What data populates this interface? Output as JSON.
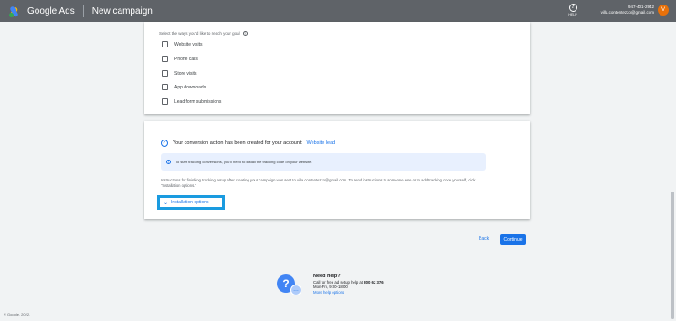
{
  "header": {
    "app_name": "Google Ads",
    "page_title": "New campaign",
    "help_label": "HELP",
    "account_phone": "947-401-2942",
    "account_email": "villa.contentezzo@gmail.com",
    "avatar_letter": "V"
  },
  "goals": {
    "label": "Select the ways you'd like to reach your goal",
    "options": [
      "Website visits",
      "Phone calls",
      "Store visits",
      "App downloads",
      "Lead form submissions"
    ]
  },
  "conversion": {
    "success_text": "Your conversion action has been created for your account:",
    "success_link": "Website lead",
    "info_text": "To start tracking conversions, you'll need to install the tracking code on your website.",
    "instructions": "Instructions for finishing tracking setup after creating your campaign was sent to villa.contentezzo@gmail.com. To send instructions to someone else or to add tracking code yourself, click \"Installation options.\"",
    "install_options": "Installation options"
  },
  "actions": {
    "back": "Back",
    "continue": "Continue"
  },
  "help_footer": {
    "title": "Need help?",
    "line1_prefix": "Call for free ad setup help at ",
    "phone": "800 62 376",
    "line2": "Mon-Fri, 9:00-18:00",
    "link": "More help options"
  },
  "footer": {
    "copyright": "© Google, 2022."
  },
  "colors": {
    "accent": "#1a73e8",
    "header_bg": "#5f6368",
    "highlight_border": "#1a9be0"
  }
}
